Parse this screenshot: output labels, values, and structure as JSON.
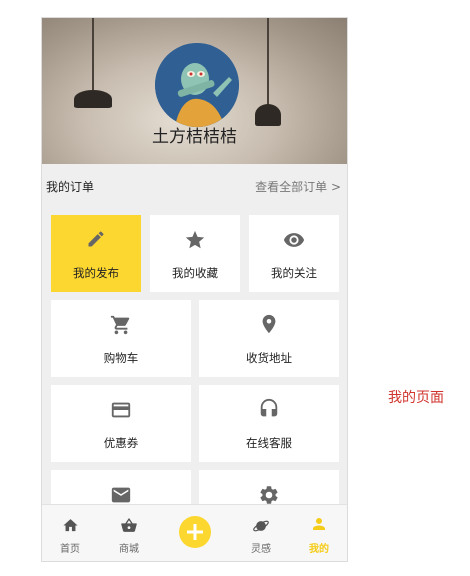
{
  "profile": {
    "name": "土方桔桔桔"
  },
  "orders": {
    "title": "我的订单",
    "view_all": "查看全部订单 >"
  },
  "grid_top": [
    {
      "label": "我的发布",
      "icon": "pencil-icon",
      "active": true
    },
    {
      "label": "我的收藏",
      "icon": "star-icon",
      "active": false
    },
    {
      "label": "我的关注",
      "icon": "eye-icon",
      "active": false
    }
  ],
  "grid_bottom": [
    {
      "label": "购物车",
      "icon": "cart-icon"
    },
    {
      "label": "收货地址",
      "icon": "location-pin-icon"
    },
    {
      "label": "优惠券",
      "icon": "credit-card-icon"
    },
    {
      "label": "在线客服",
      "icon": "headphones-icon"
    },
    {
      "label": "",
      "icon": "mail-icon"
    },
    {
      "label": "",
      "icon": "gear-icon"
    }
  ],
  "tabs": [
    {
      "label": "首页",
      "icon": "home-icon"
    },
    {
      "label": "商城",
      "icon": "shopping-basket-icon"
    },
    {
      "label": "",
      "icon": "plus-icon"
    },
    {
      "label": "灵感",
      "icon": "planet-icon"
    },
    {
      "label": "我的",
      "icon": "person-icon",
      "active": true
    }
  ],
  "colors": {
    "accent": "#fcd730",
    "icon_gray": "#666666",
    "caption_red": "#d0342c"
  },
  "caption": "我的页面"
}
